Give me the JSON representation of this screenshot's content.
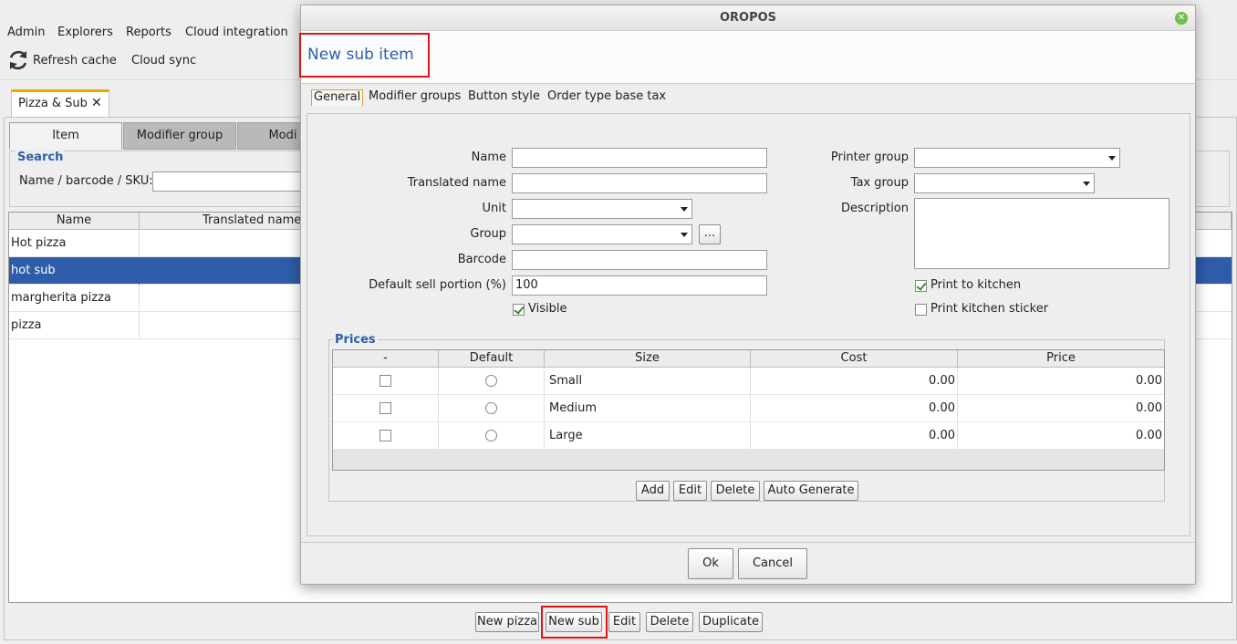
{
  "menu": [
    "Admin",
    "Explorers",
    "Reports",
    "Cloud integration"
  ],
  "toolbar": {
    "refresh": "Refresh cache",
    "sync": "Cloud sync"
  },
  "main_tab": {
    "label": "Pizza & Sub",
    "close": "✕"
  },
  "subtabs": [
    "Item",
    "Modifier group",
    "Modi"
  ],
  "search": {
    "title": "Search",
    "label": "Name / barcode / SKU:"
  },
  "table": {
    "headers": [
      "Name",
      "Translated name"
    ],
    "rows": [
      "Hot pizza",
      "hot sub",
      "margherita pizza",
      "pizza"
    ]
  },
  "bottom_buttons": {
    "new_pizza": "New pizza",
    "new_sub": "New sub",
    "edit": "Edit",
    "delete": "Delete",
    "duplicate": "Duplicate"
  },
  "dialog": {
    "window_title": "OROPOS",
    "heading": "New sub item",
    "tabs": [
      "General",
      "Modifier groups",
      "Button style",
      "Order type base tax"
    ],
    "labels": {
      "name": "Name",
      "translated_name": "Translated name",
      "unit": "Unit",
      "group": "Group",
      "barcode": "Barcode",
      "default_sell_portion": "Default sell portion (%)",
      "visible": "Visible",
      "printer_group": "Printer group",
      "tax_group": "Tax group",
      "description": "Description",
      "print_to_kitchen": "Print to kitchen",
      "print_kitchen_sticker": "Print kitchen sticker"
    },
    "values": {
      "default_sell_portion": "100",
      "group_browse": "..."
    },
    "checks": {
      "visible": true,
      "print_to_kitchen": true,
      "print_kitchen_sticker": false
    },
    "prices": {
      "title": "Prices",
      "headers": [
        "-",
        "Default",
        "Size",
        "Cost",
        "Price"
      ],
      "rows": [
        {
          "size": "Small",
          "cost": "0.00",
          "price": "0.00"
        },
        {
          "size": "Medium",
          "cost": "0.00",
          "price": "0.00"
        },
        {
          "size": "Large",
          "cost": "0.00",
          "price": "0.00"
        }
      ],
      "buttons": {
        "add": "Add",
        "edit": "Edit",
        "delete": "Delete",
        "auto": "Auto Generate"
      }
    },
    "footer": {
      "ok": "Ok",
      "cancel": "Cancel"
    }
  }
}
